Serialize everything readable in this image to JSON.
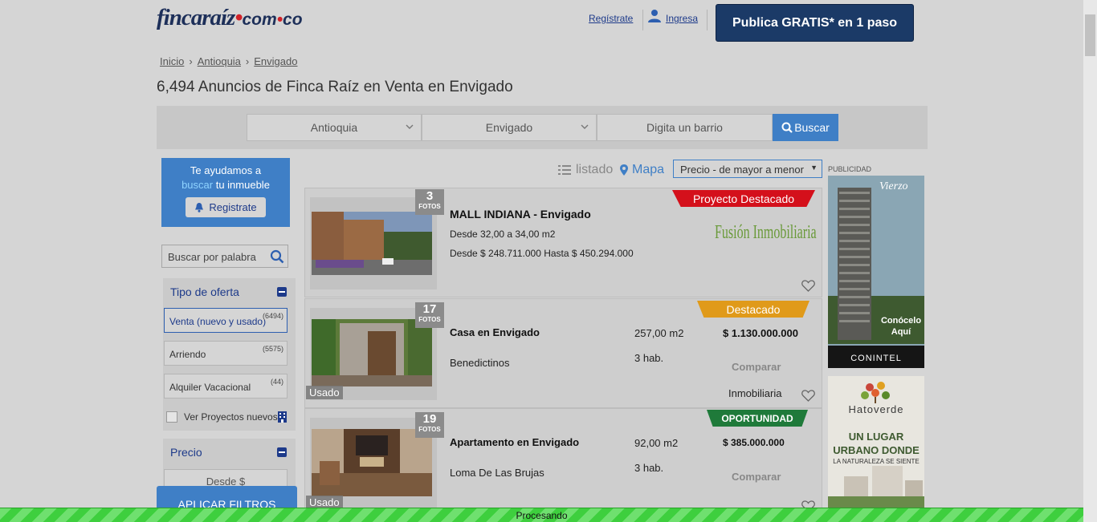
{
  "header": {
    "logo_main": "fincaraíz",
    "logo_dom": "com",
    "logo_tld": "co",
    "register_link": "Regístrate",
    "login_link": "Ingresa",
    "publish_button": "Publica GRATIS* en 1 paso"
  },
  "breadcrumb": [
    "Inicio",
    "Antioquia",
    "Envigado"
  ],
  "page_title": "6,494 Anuncios de Finca Raíz en Venta en Envigado",
  "search": {
    "department": "Antioquia",
    "city": "Envigado",
    "neighborhood_placeholder": "Digita un barrio",
    "button": "Buscar"
  },
  "sidebar": {
    "help_line1": "Te ayudamos a",
    "help_highlight": "buscar",
    "help_line2": "tu inmueble",
    "help_button": "Registrate",
    "keyword_placeholder": "Buscar por palabra",
    "offer_type_title": "Tipo de oferta",
    "offer_options": [
      {
        "label": "Venta (nuevo y usado)",
        "count": "(6494)"
      },
      {
        "label": "Arriendo",
        "count": "(5575)"
      },
      {
        "label": "Alquiler Vacacional",
        "count": "(44)"
      }
    ],
    "projects_checkbox": "Ver Proyectos nuevos",
    "price_title": "Precio",
    "price_from": "Desde $",
    "apply_button": "APLICAR FILTROS"
  },
  "results": {
    "view_list": "listado",
    "view_map": "Mapa",
    "sort_selected": "Precio - de mayor a menor",
    "fotos_label": "FOTOS",
    "listings": [
      {
        "photos": "3",
        "ribbon": "Proyecto Destacado",
        "ribbon_color": "#d4101b",
        "title": "MALL INDIANA - Envigado",
        "line1": "Desde 32,00 a 34,00 m2",
        "line2": "Desde $ 248.711.000 Hasta $ 450.294.000",
        "agency_logo": "Fusión Inmobiliaria"
      },
      {
        "photos": "17",
        "ribbon": "Destacado",
        "ribbon_color": "#e09a1a",
        "title": "Casa en Envigado",
        "area": "257,00 m2",
        "price": "$ 1.130.000.000",
        "neighborhood": "Benedictinos",
        "rooms": "3 hab.",
        "compare": "Comparar",
        "seller": "Inmobiliaria",
        "tag": "Usado"
      },
      {
        "photos": "19",
        "ribbon": "OPORTUNIDAD",
        "ribbon_color": "#1f7a3a",
        "title": "Apartamento en Envigado",
        "area": "92,00 m2",
        "price": "$ 385.000.000",
        "neighborhood": "Loma De Las Brujas",
        "rooms": "3 hab.",
        "compare": "Comparar",
        "tag": "Usado"
      }
    ]
  },
  "ads": {
    "label": "PUBLICIDAD",
    "ad1_brand": "Vierzo",
    "ad1_cta": "Conócelo Aquí",
    "ad1_footer": "CONINTEL",
    "ad2_brand": "Hatoverde",
    "ad2_headline1": "UN LUGAR",
    "ad2_headline2": "URBANO DONDE",
    "ad2_sub": "LA NATURALEZA SE SIENTE"
  },
  "status": "Procesando"
}
